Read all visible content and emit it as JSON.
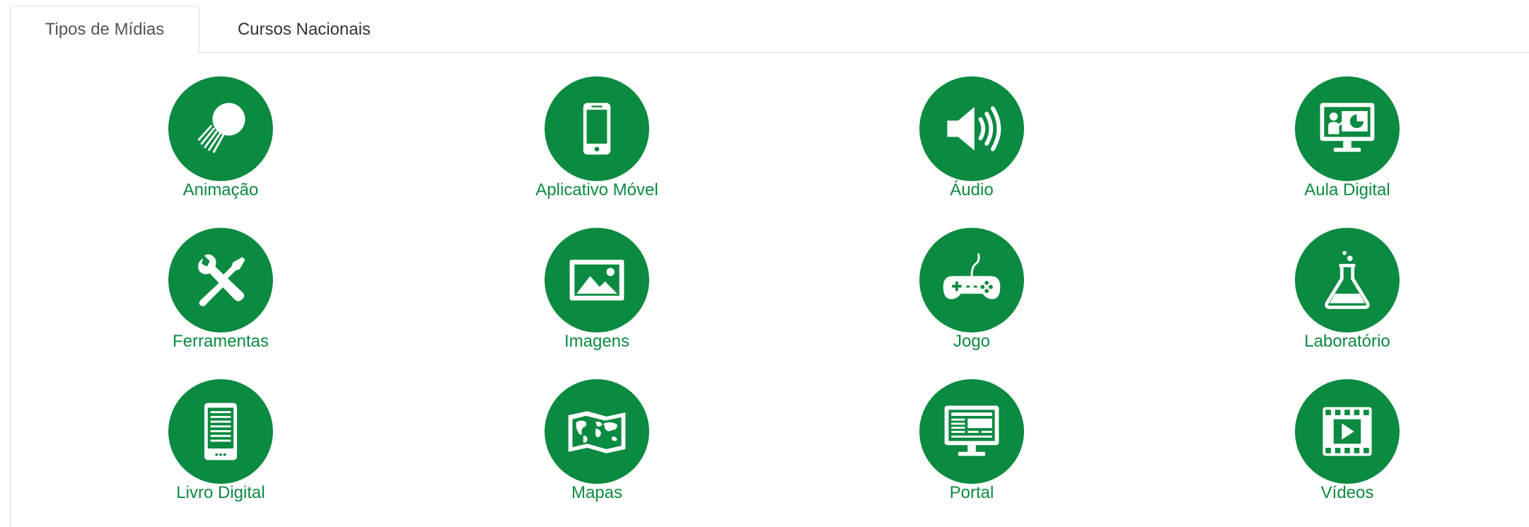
{
  "tabs": {
    "tipos_midias": "Tipos de Mídias",
    "cursos_nacionais": "Cursos Nacionais"
  },
  "media_types": [
    {
      "label": "Animação",
      "icon": "animation-icon"
    },
    {
      "label": "Aplicativo Móvel",
      "icon": "mobile-phone-icon"
    },
    {
      "label": "Áudio",
      "icon": "speaker-icon"
    },
    {
      "label": "Aula Digital",
      "icon": "presentation-monitor-icon"
    },
    {
      "label": "Ferramentas",
      "icon": "tools-icon"
    },
    {
      "label": "Imagens",
      "icon": "image-icon"
    },
    {
      "label": "Jogo",
      "icon": "gamepad-icon"
    },
    {
      "label": "Laboratório",
      "icon": "flask-icon"
    },
    {
      "label": "Livro Digital",
      "icon": "ebook-icon"
    },
    {
      "label": "Mapas",
      "icon": "world-map-icon"
    },
    {
      "label": "Portal",
      "icon": "web-portal-icon"
    },
    {
      "label": "Vídeos",
      "icon": "video-film-icon"
    }
  ],
  "colors": {
    "accent": "#0b8a41",
    "tab_text": "#333333",
    "border": "#dddddd"
  }
}
